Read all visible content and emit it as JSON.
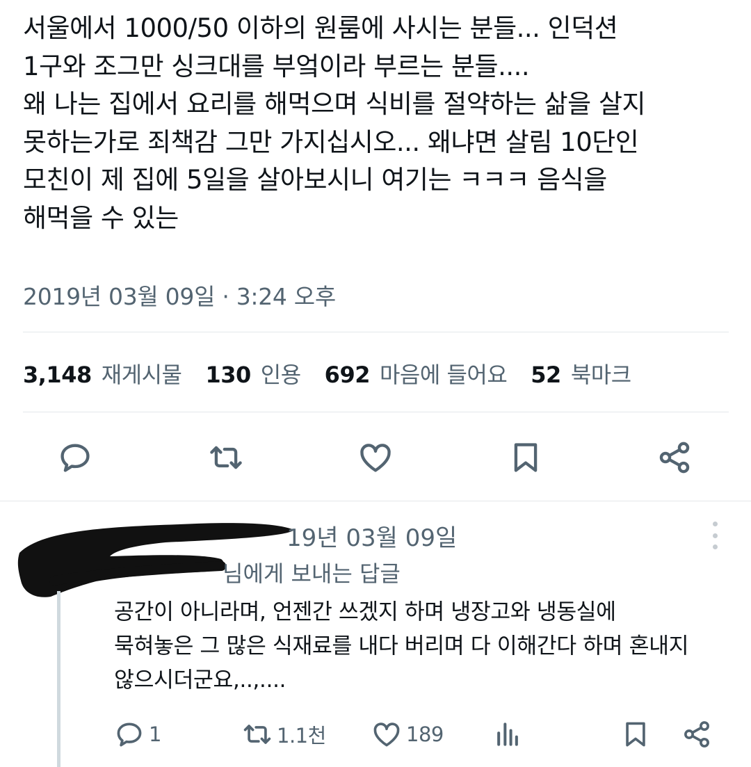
{
  "tweet": {
    "text": "서울에서 1000/50 이하의 원룸에 사시는 분들... 인덕션\n1구와 조그만 싱크대를 부엌이라 부르는 분들....\n왜 나는 집에서 요리를 해먹으며 식비를 절약하는 삶을 살지\n못하는가로 죄책감 그만 가지십시오... 왜냐면 살림 10단인\n모친이 제 집에 5일을 살아보시니 여기는 ㅋㅋㅋ 음식을\n해먹을 수 있는",
    "timestamp": "2019년 03월 09일 · 3:24 오후"
  },
  "stats": [
    {
      "num": "3,148",
      "label": "재게시물"
    },
    {
      "num": "130",
      "label": "인용"
    },
    {
      "num": "692",
      "label": "마음에 들어요"
    },
    {
      "num": "52",
      "label": "북마크"
    }
  ],
  "actions": [
    "reply-icon",
    "retweet-icon",
    "like-icon",
    "bookmark-icon",
    "share-icon"
  ],
  "reply": {
    "date": "19년 03월 09일",
    "reply_to": "님에게 보내는 답글",
    "text": "공간이 아니라며, 언젠간 쓰겠지 하며 냉장고와 냉동실에\n묵혀놓은 그 많은 식재료를 내다 버리며 다 이해간다 하며 혼내지\n않으시더군요,..,....",
    "counts": {
      "replies": "1",
      "retweets": "1.1천",
      "likes": "189"
    }
  },
  "colors": {
    "text": "#0f1419",
    "secondary": "#536471",
    "icon": "#536471",
    "divider": "#e3e7ea"
  }
}
